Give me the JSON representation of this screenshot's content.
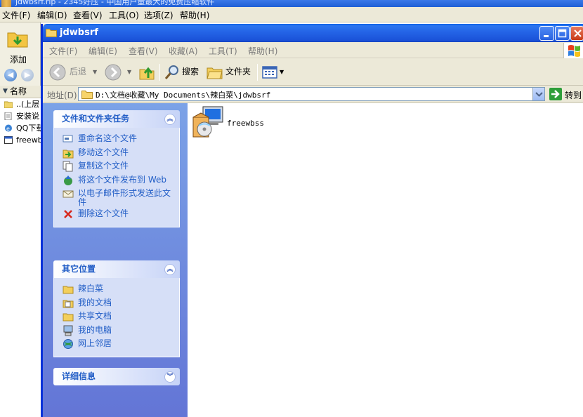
{
  "background_app": {
    "title": "jdwbsrf.rip - 2345好压 - 中国用户量最大的免费压缩软件",
    "menu": [
      "文件(F)",
      "编辑(D)",
      "查看(V)",
      "工具(O)",
      "选项(Z)",
      "帮助(H)"
    ],
    "add_label": "添加",
    "list_header": "名称",
    "rows": [
      {
        "label": "..(上层",
        "icon": "folder-icon"
      },
      {
        "label": "安装说",
        "icon": "text-file-icon"
      },
      {
        "label": "QQ下载",
        "icon": "ie-icon"
      },
      {
        "label": "freewb",
        "icon": "exe-icon"
      }
    ]
  },
  "window": {
    "title": "jdwbsrf",
    "menu": [
      "文件(F)",
      "编辑(E)",
      "查看(V)",
      "收藏(A)",
      "工具(T)",
      "帮助(H)"
    ],
    "toolbar": {
      "back": "后退",
      "search": "搜索",
      "folders": "文件夹"
    },
    "address": {
      "label": "地址(D)",
      "path": "D:\\文档@收藏\\My Documents\\辣白菜\\jdwbsrf",
      "go": "转到"
    }
  },
  "taskpane": {
    "file_tasks": {
      "title": "文件和文件夹任务",
      "items": [
        {
          "label": "重命名这个文件",
          "icon": "rename-icon"
        },
        {
          "label": "移动这个文件",
          "icon": "move-icon"
        },
        {
          "label": "复制这个文件",
          "icon": "copy-icon"
        },
        {
          "label": "将这个文件发布到 Web",
          "icon": "publish-web-icon"
        },
        {
          "label": "以电子邮件形式发送此文件",
          "icon": "email-icon"
        },
        {
          "label": "删除这个文件",
          "icon": "delete-icon"
        }
      ]
    },
    "other_places": {
      "title": "其它位置",
      "items": [
        {
          "label": "辣白菜",
          "icon": "folder-icon"
        },
        {
          "label": "我的文档",
          "icon": "my-documents-icon"
        },
        {
          "label": "共享文档",
          "icon": "shared-documents-icon"
        },
        {
          "label": "我的电脑",
          "icon": "my-computer-icon"
        },
        {
          "label": "网上邻居",
          "icon": "network-icon"
        }
      ]
    },
    "details": {
      "title": "详细信息"
    }
  },
  "files": [
    {
      "name": "freewbss",
      "icon": "installer-icon"
    }
  ],
  "colors": {
    "titlebar": "#2464e6",
    "taskpane": "#6375d6",
    "link": "#215dc6"
  }
}
